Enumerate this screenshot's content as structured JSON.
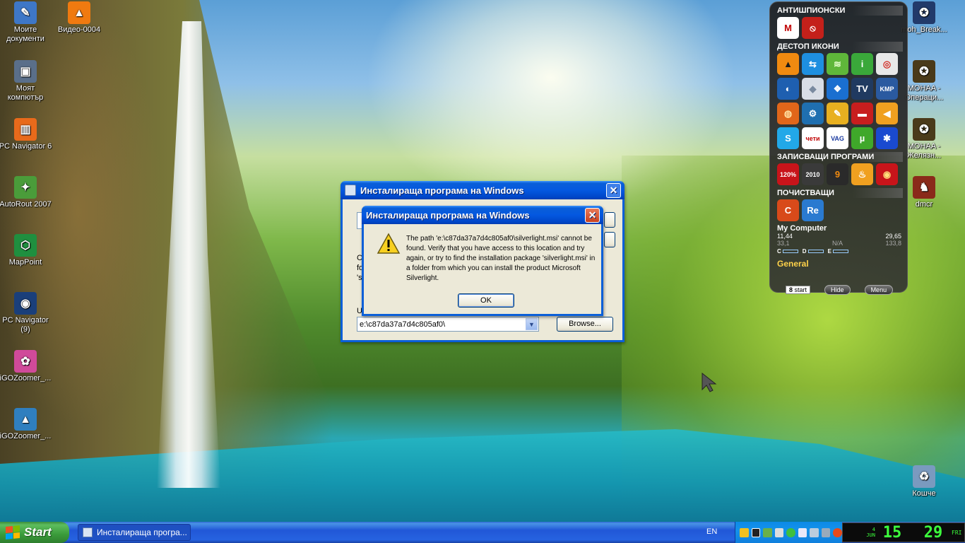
{
  "desktop_icons": [
    {
      "label": "Моите документи",
      "color": "#3e77c7",
      "glyph": "✎"
    },
    {
      "label": "Видео-0004",
      "color": "#f07a10",
      "glyph": "▲"
    },
    {
      "label": "Моят компютър",
      "color": "#5a6f8a",
      "glyph": "▣"
    },
    {
      "label": "PC Navigator 6",
      "color": "#e86a1b",
      "glyph": "▥"
    },
    {
      "label": "AutoRout 2007",
      "color": "#4a9c3a",
      "glyph": "✦"
    },
    {
      "label": "MapPoint",
      "color": "#1f8f3f",
      "glyph": "⬡"
    },
    {
      "label": "PC Navigator (9)",
      "color": "#1a3f7a",
      "glyph": "◉"
    },
    {
      "label": "iGOZoomer_...",
      "color": "#d04a9a",
      "glyph": "✿"
    },
    {
      "label": "iGOZoomer_...",
      "color": "#2f7fbf",
      "glyph": "▲"
    },
    {
      "label": "moh_Break...",
      "color": "#223a6a",
      "glyph": "✪"
    },
    {
      "label": "MOHAA - Операци...",
      "color": "#4a3a1a",
      "glyph": "✪"
    },
    {
      "label": "MOHAA - Желязн...",
      "color": "#4a3a1a",
      "glyph": "✪"
    },
    {
      "label": "dmcr",
      "color": "#8a2a1a",
      "glyph": "♞"
    },
    {
      "label": "Кошче",
      "color": "#7a9abf",
      "glyph": "♻"
    }
  ],
  "gadget": {
    "section_antispy": "АНТИШПИОНСКИ",
    "antispy_icons": [
      {
        "name": "malwarebytes-icon",
        "color": "#ffffff",
        "text": "M",
        "fg": "#c00000"
      },
      {
        "name": "spybot-icon",
        "color": "#c4201a",
        "text": "⦸",
        "fg": "#ffffff"
      }
    ],
    "section_desktop": "ДЕСТОП ИКОНИ",
    "desktop_rows": [
      [
        {
          "name": "avast-icon",
          "color": "#f08a10",
          "text": "▲",
          "fg": "#1a1a1a"
        },
        {
          "name": "teamviewer-icon",
          "color": "#1e8fe0",
          "text": "⇆",
          "fg": "#ffffff"
        },
        {
          "name": "grass-icon",
          "color": "#5fb73a",
          "text": "≋",
          "fg": "#e8ffd0"
        },
        {
          "name": "info-icon",
          "color": "#3aa83a",
          "text": "i",
          "fg": "#ffffff"
        },
        {
          "name": "chrome-icon",
          "color": "#e8e8e8",
          "text": "◎",
          "fg": "#d22f27"
        }
      ],
      [
        {
          "name": "google-earth-icon",
          "color": "#1e5fb0",
          "text": "◐",
          "fg": "#ffffff"
        },
        {
          "name": "crystal-icon",
          "color": "#d8dde6",
          "text": "◆",
          "fg": "#7a8aa0"
        },
        {
          "name": "windows-xp-icon",
          "color": "#1a6fd0",
          "text": "❖",
          "fg": "#ffffff"
        },
        {
          "name": "tv-icon",
          "color": "#203a60",
          "text": "TV",
          "fg": "#ffffff"
        },
        {
          "name": "kmplayer-icon",
          "color": "#2a5aa0",
          "text": "KMP",
          "fg": "#ffffff"
        }
      ],
      [
        {
          "name": "firefox-icon",
          "color": "#e0661a",
          "text": "◍",
          "fg": "#ffe0a0"
        },
        {
          "name": "network-icon",
          "color": "#1f6fb0",
          "text": "⚙",
          "fg": "#ffffff"
        },
        {
          "name": "paint-icon",
          "color": "#e8b020",
          "text": "✎",
          "fg": "#ffffff"
        },
        {
          "name": "screen-icon",
          "color": "#c81e1e",
          "text": "▬",
          "fg": "#ffffff"
        },
        {
          "name": "back-icon",
          "color": "#f0a020",
          "text": "◀",
          "fg": "#ffffff"
        }
      ],
      [
        {
          "name": "skype-icon",
          "color": "#22a8e8",
          "text": "S",
          "fg": "#ffffff"
        },
        {
          "name": "audio-icon",
          "color": "#ffffff",
          "text": "чети",
          "fg": "#c00000"
        },
        {
          "name": "vag-com-icon",
          "color": "#ffffff",
          "text": "VAG",
          "fg": "#1a3aa0"
        },
        {
          "name": "utorrent-icon",
          "color": "#3fa82a",
          "text": "µ",
          "fg": "#ffffff"
        },
        {
          "name": "bluetooth-icon",
          "color": "#1a4ad0",
          "text": "✱",
          "fg": "#ffffff"
        }
      ]
    ],
    "section_burn": "ЗАПИСВАЩИ ПРОГРАМИ",
    "burn_icons": [
      {
        "name": "alcohol-120-icon",
        "color": "#c8141a",
        "text": "120%",
        "fg": "#ffffff"
      },
      {
        "name": "nero-2010-icon",
        "color": "#3a3a3a",
        "text": "2010",
        "fg": "#ffffff"
      },
      {
        "name": "nero-9-icon",
        "color": "#2a2a2a",
        "text": "9",
        "fg": "#f08a10"
      },
      {
        "name": "burn-fire-icon",
        "color": "#f0a020",
        "text": "♨",
        "fg": "#ffffff"
      },
      {
        "name": "burning-rom-icon",
        "color": "#c8141a",
        "text": "◉",
        "fg": "#ffe07a"
      }
    ],
    "section_clean": "ПОЧИСТВАЩИ",
    "clean_icons": [
      {
        "name": "ccleaner-icon",
        "color": "#d84a1a",
        "text": "C",
        "fg": "#ffffff"
      },
      {
        "name": "revo-icon",
        "color": "#2a7ad0",
        "text": "Re",
        "fg": "#ffffff"
      }
    ],
    "mycomputer_title": "My Computer",
    "stat_left_top": "11,44",
    "stat_left_bottom": "33,1",
    "stat_mid": "N/A",
    "stat_right_top": "29,65",
    "stat_right_bottom": "133,8",
    "drive_c": "C",
    "drive_d": "D",
    "drive_e": "E",
    "general_label": "General",
    "start_label": "start",
    "start_num": "8",
    "hide_label": "Hide",
    "menu_label": "Menu"
  },
  "installer_window": {
    "title": "Инсталираща програма на Windows",
    "partial_line1": "C",
    "partial_line2": "fo",
    "partial_line3": "'s",
    "partial_label": "U",
    "path_value": "e:\\c87da37a7d4c805af0\\",
    "browse_label": "Browse..."
  },
  "error_dialog": {
    "title": "Инсталираща програма на Windows",
    "message": "The path 'e:\\c87da37a7d4c805af0\\silverlight.msi' cannot be found. Verify that you have access to this location and try again, or try to find the installation package 'silverlight.msi' in a folder from which you can install the product Microsoft Silverlight.",
    "ok_label": "OK"
  },
  "taskbar": {
    "start_label": "Start",
    "task_label": "Инсталираща програ...",
    "lang": "EN",
    "clock_hour": "15",
    "clock_min": "29",
    "clock_day": "4",
    "clock_month": "JUN",
    "clock_weekday": "FRI"
  }
}
